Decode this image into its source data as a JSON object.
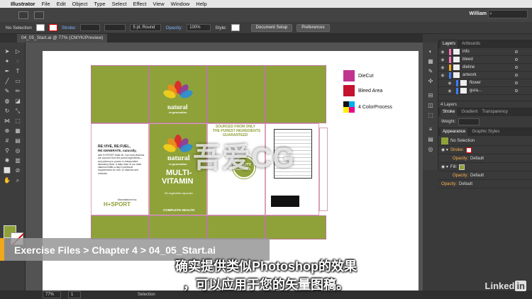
{
  "menubar": {
    "apple": "",
    "app": "Illustrator",
    "items": [
      "File",
      "Edit",
      "Object",
      "Type",
      "Select",
      "Effect",
      "View",
      "Window",
      "Help"
    ]
  },
  "appbar": {
    "logo": "Ai",
    "workspace": "William",
    "search_icon": "magnifier-icon"
  },
  "control_bar": {
    "selection": "No Selection",
    "stroke_label": "Stroke:",
    "brush": "5 pt. Round",
    "opacity_label": "Opacity:",
    "opacity_value": "100%",
    "style_label": "Style:",
    "doc_setup": "Document Setup",
    "preferences": "Preferences"
  },
  "document": {
    "tab": "04_05_Start.ai @ 77% (CMYK/Preview)"
  },
  "legend": [
    {
      "label": "DieCut",
      "color": "#c0348f"
    },
    {
      "label": "Bleed Area",
      "color": "#c4122f"
    },
    {
      "label": "4 ColorProcess",
      "color": "#1a1a1a"
    }
  ],
  "package": {
    "brand_top": "natural",
    "brand_sub": "re:generation",
    "front_title_1": "MULTI-",
    "front_title_2": "VITAMIN",
    "front_caps": "36 vegetable capsules",
    "front_footer": "COMPLETE HEALTH",
    "side_headline_1": "RE:VIVE, RE:FUEL,",
    "side_headline_2": "RE:GENERATE, naturally,",
    "side_body": "with H+SPORT Multi-Vit. Our multi-vitamins are sourced from the purest ingredients—and potency is proven in independent laboratory tests. A daily dose of our multi-vitamins fulfills a day's nutritional requirements for over 12 vitamins and minerals.",
    "manufactured_by": "Manufactured by:",
    "maker": "H+SPORT",
    "sourced_1": "SOURCED FROM ONLY",
    "sourced_2": "THE PUREST INGREDIENTS",
    "guaranteed": "GUARANTEED",
    "quality_1": "QUALITY",
    "quality_2": "GUARANTEE"
  },
  "panels": {
    "layers_tabs": [
      "Layers",
      "Artboards"
    ],
    "layers": [
      {
        "name": "info",
        "color": "#ff6eb4"
      },
      {
        "name": "bleed",
        "color": "#ff6eb4"
      },
      {
        "name": "dieline",
        "color": "#f0a81c"
      },
      {
        "name": "artwork",
        "color": "#3a7dff"
      },
      {
        "name": "flower",
        "color": "#3a7dff"
      },
      {
        "name": "gura...",
        "color": "#3a7dff"
      }
    ],
    "layers_count": "4 Layers",
    "stroke_tabs": [
      "Stroke",
      "Gradient",
      "Transparency"
    ],
    "weight_label": "Weight:",
    "appearance_tabs": [
      "Appearance",
      "Graphic Styles"
    ],
    "appearance_title": "No Selection",
    "stroke_row": "Stroke:",
    "opacity_row": "Opacity:",
    "opacity_default": "Default",
    "fill_row": "Fill:"
  },
  "status": {
    "zoom": "77%",
    "artboard": "1",
    "tool": "Selection"
  },
  "breadcrumb": "Exercise Files > Chapter 4 > 04_05_Start.ai",
  "subtitles": [
    "确实提供类似Photoshop的效果",
    "，可以应用于您的矢量图稿。"
  ],
  "watermark": "吾爱CG",
  "brand_logo": "Linked",
  "brand_logo_in": "in"
}
